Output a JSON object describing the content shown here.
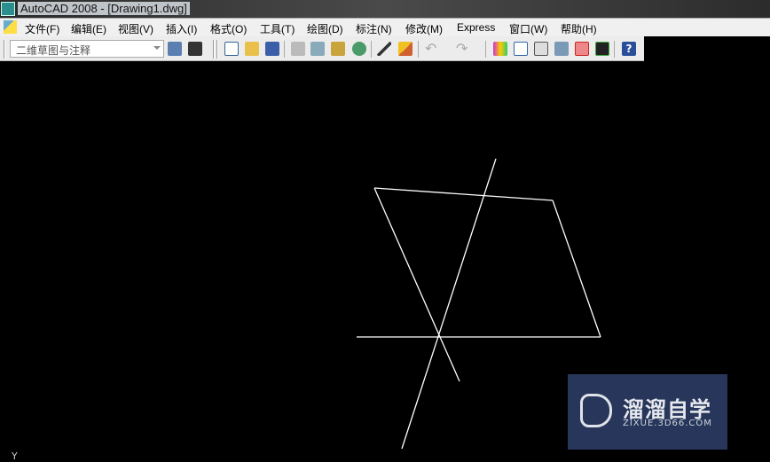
{
  "title": "AutoCAD 2008 - [Drawing1.dwg]",
  "menu": [
    "文件(F)",
    "编辑(E)",
    "视图(V)",
    "插入(I)",
    "格式(O)",
    "工具(T)",
    "绘图(D)",
    "标注(N)",
    "修改(M)",
    "Express",
    "窗口(W)",
    "帮助(H)"
  ],
  "toolbar": {
    "workspace": "二维草图与注释",
    "help_label": "?"
  },
  "ucs": {
    "y_label": "Y"
  },
  "watermark": {
    "name": "溜溜自学",
    "url": "ZIXUE.3D66.COM"
  },
  "colors": {
    "canvas": "#000000",
    "lines": "#ffffff",
    "watermark_bg": "#27365a"
  }
}
